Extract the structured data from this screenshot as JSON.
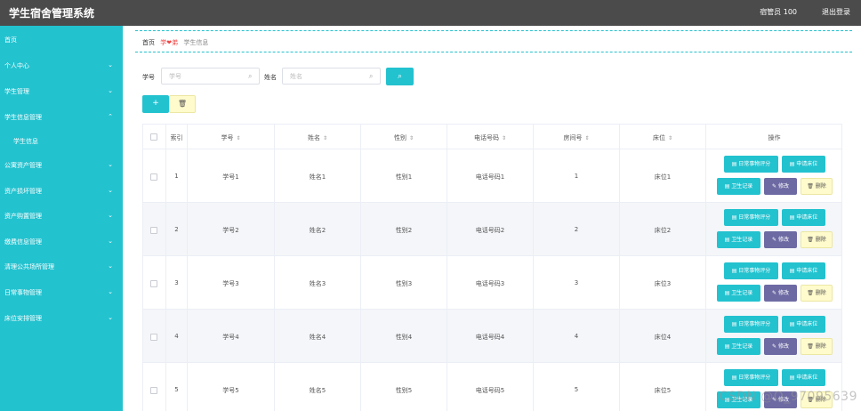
{
  "header": {
    "title": "学生宿舍管理系统",
    "user": "宿管员 100",
    "logout": "退出登录"
  },
  "sidebar": {
    "items": [
      {
        "label": "首页",
        "chevron": ""
      },
      {
        "label": "个人中心",
        "chevron": "⌄"
      },
      {
        "label": "学生管理",
        "chevron": "⌄"
      },
      {
        "label": "学生信息管理",
        "chevron": "⌃"
      },
      {
        "label": "学生信息",
        "chevron": ""
      },
      {
        "label": "公寓资产管理",
        "chevron": "⌄"
      },
      {
        "label": "资产损坏管理",
        "chevron": "⌄"
      },
      {
        "label": "资产购置管理",
        "chevron": "⌄"
      },
      {
        "label": "缴费信息管理",
        "chevron": "⌄"
      },
      {
        "label": "清理公共场所管理",
        "chevron": "⌄"
      },
      {
        "label": "日常事物管理",
        "chevron": "⌄"
      },
      {
        "label": "床位安排管理",
        "chevron": "⌄"
      }
    ]
  },
  "breadcrumb": {
    "home": "首页",
    "middle": "学❤弟",
    "current": "学生信息"
  },
  "search": {
    "student_id_label": "学号",
    "student_id_placeholder": "学号",
    "name_label": "姓名",
    "name_placeholder": "姓名",
    "search_icon": "search-icon",
    "search_glyph": "⌕"
  },
  "toolbar": {
    "add_glyph": "+",
    "delete_glyph": "🗑"
  },
  "table": {
    "headers": {
      "index": "索引",
      "student_id": "学号",
      "name": "姓名",
      "gender": "性别",
      "phone": "电话号码",
      "room": "房间号",
      "bed": "床位",
      "actions": "操作"
    },
    "sort_glyph": "⇕",
    "rows": [
      {
        "index": "1",
        "student_id": "学号1",
        "name": "姓名1",
        "gender": "性别1",
        "phone": "电话号码1",
        "room": "1",
        "bed": "床位1"
      },
      {
        "index": "2",
        "student_id": "学号2",
        "name": "姓名2",
        "gender": "性别2",
        "phone": "电话号码2",
        "room": "2",
        "bed": "床位2"
      },
      {
        "index": "3",
        "student_id": "学号3",
        "name": "姓名3",
        "gender": "性别3",
        "phone": "电话号码3",
        "room": "3",
        "bed": "床位3"
      },
      {
        "index": "4",
        "student_id": "学号4",
        "name": "姓名4",
        "gender": "性别4",
        "phone": "电话号码4",
        "room": "4",
        "bed": "床位4"
      },
      {
        "index": "5",
        "student_id": "学号5",
        "name": "姓名5",
        "gender": "性别5",
        "phone": "电话号码5",
        "room": "5",
        "bed": "床位5"
      }
    ],
    "actions": {
      "eval": "▤ 日常事物评分",
      "apply": "▤ 申请床位",
      "hygiene": "▤ 卫生记录",
      "edit": "✎ 修改",
      "delete": "🗑 删除"
    }
  },
  "watermark": "CSDN @Q_97095639",
  "colors": {
    "accent": "#23c2cf",
    "header_bg": "#4b4b4b",
    "edit": "#6d6aa3",
    "delete_bg": "#fffbcc"
  }
}
